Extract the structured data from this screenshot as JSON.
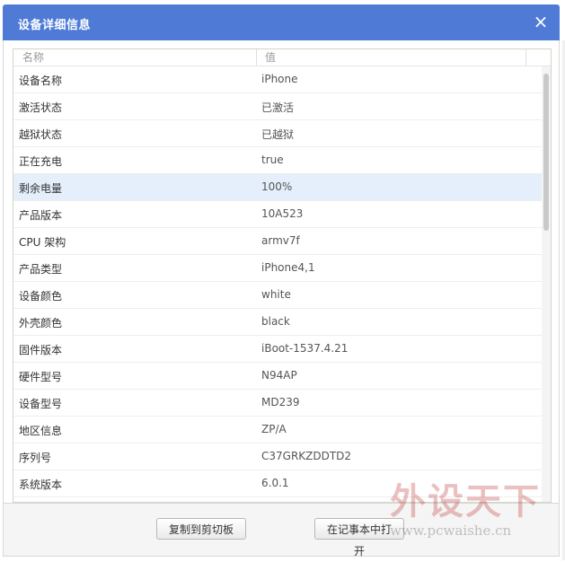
{
  "dialog": {
    "title": "设备详细信息",
    "close_glyph": "×"
  },
  "table": {
    "headers": {
      "name": "名称",
      "value": "值"
    },
    "selected_index": 4,
    "rows": [
      {
        "name": "设备名称",
        "value": "iPhone"
      },
      {
        "name": "激活状态",
        "value": "已激活"
      },
      {
        "name": "越狱状态",
        "value": "已越狱"
      },
      {
        "name": "正在充电",
        "value": "true"
      },
      {
        "name": "剩余电量",
        "value": "100%"
      },
      {
        "name": "产品版本",
        "value": "10A523"
      },
      {
        "name": "CPU 架构",
        "value": "armv7f"
      },
      {
        "name": "产品类型",
        "value": "iPhone4,1"
      },
      {
        "name": "设备颜色",
        "value": "white"
      },
      {
        "name": "外壳颜色",
        "value": "black"
      },
      {
        "name": "固件版本",
        "value": "iBoot-1537.4.21"
      },
      {
        "name": "硬件型号",
        "value": "N94AP"
      },
      {
        "name": "设备型号",
        "value": "MD239"
      },
      {
        "name": "地区信息",
        "value": "ZP/A"
      },
      {
        "name": "序列号",
        "value": "C37GRKZDDTD2"
      },
      {
        "name": "系统版本",
        "value": "6.0.1"
      }
    ]
  },
  "footer": {
    "copy_label": "复制到剪切板",
    "open_label": "在记事本中打开"
  },
  "watermark": {
    "brand": "外设天下",
    "url": "www.pcwaishe.cn"
  },
  "colors": {
    "titlebar": "#4f7bd6",
    "selected_row": "#e4effb"
  }
}
